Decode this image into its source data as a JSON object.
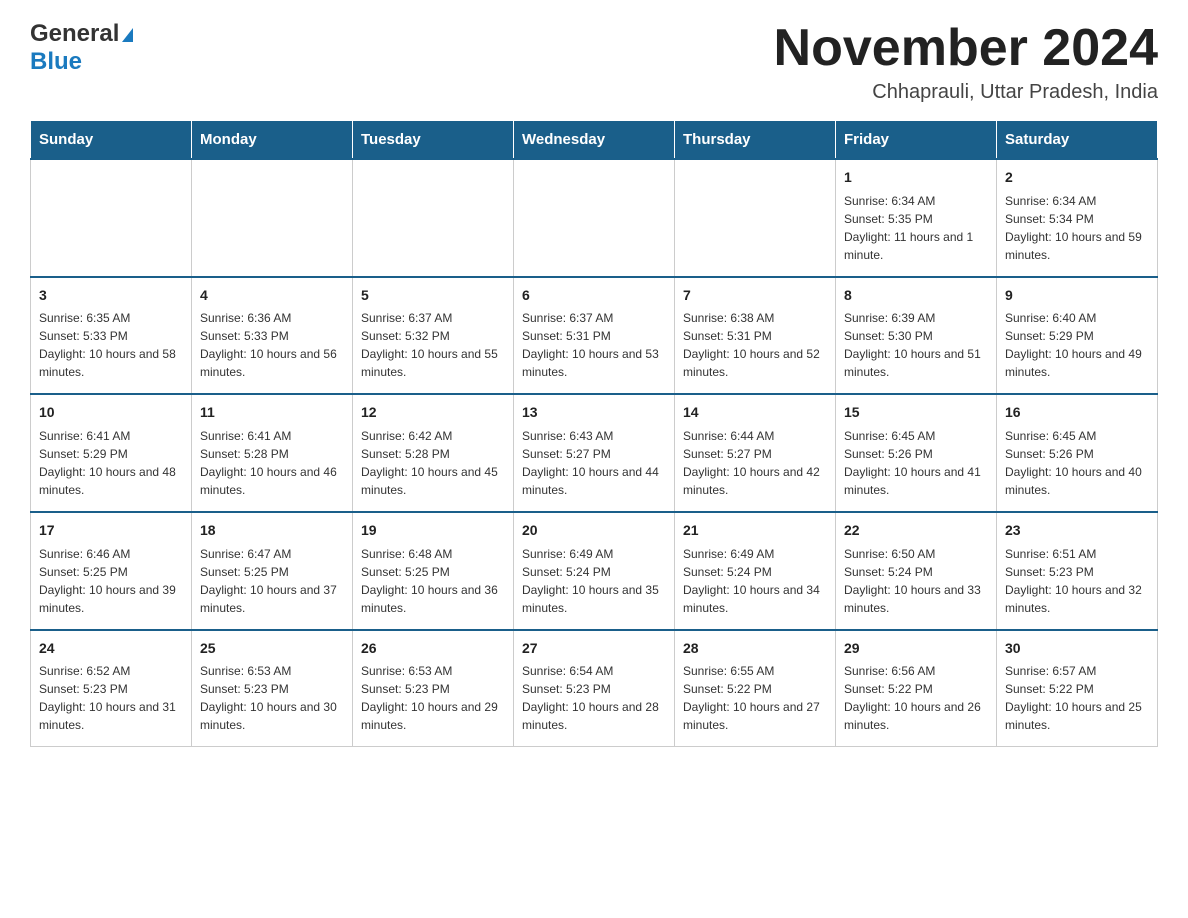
{
  "header": {
    "logo_general": "General",
    "logo_blue": "Blue",
    "month_title": "November 2024",
    "location": "Chhaprauli, Uttar Pradesh, India"
  },
  "weekdays": [
    "Sunday",
    "Monday",
    "Tuesday",
    "Wednesday",
    "Thursday",
    "Friday",
    "Saturday"
  ],
  "weeks": [
    [
      {
        "day": "",
        "info": ""
      },
      {
        "day": "",
        "info": ""
      },
      {
        "day": "",
        "info": ""
      },
      {
        "day": "",
        "info": ""
      },
      {
        "day": "",
        "info": ""
      },
      {
        "day": "1",
        "info": "Sunrise: 6:34 AM\nSunset: 5:35 PM\nDaylight: 11 hours and 1 minute."
      },
      {
        "day": "2",
        "info": "Sunrise: 6:34 AM\nSunset: 5:34 PM\nDaylight: 10 hours and 59 minutes."
      }
    ],
    [
      {
        "day": "3",
        "info": "Sunrise: 6:35 AM\nSunset: 5:33 PM\nDaylight: 10 hours and 58 minutes."
      },
      {
        "day": "4",
        "info": "Sunrise: 6:36 AM\nSunset: 5:33 PM\nDaylight: 10 hours and 56 minutes."
      },
      {
        "day": "5",
        "info": "Sunrise: 6:37 AM\nSunset: 5:32 PM\nDaylight: 10 hours and 55 minutes."
      },
      {
        "day": "6",
        "info": "Sunrise: 6:37 AM\nSunset: 5:31 PM\nDaylight: 10 hours and 53 minutes."
      },
      {
        "day": "7",
        "info": "Sunrise: 6:38 AM\nSunset: 5:31 PM\nDaylight: 10 hours and 52 minutes."
      },
      {
        "day": "8",
        "info": "Sunrise: 6:39 AM\nSunset: 5:30 PM\nDaylight: 10 hours and 51 minutes."
      },
      {
        "day": "9",
        "info": "Sunrise: 6:40 AM\nSunset: 5:29 PM\nDaylight: 10 hours and 49 minutes."
      }
    ],
    [
      {
        "day": "10",
        "info": "Sunrise: 6:41 AM\nSunset: 5:29 PM\nDaylight: 10 hours and 48 minutes."
      },
      {
        "day": "11",
        "info": "Sunrise: 6:41 AM\nSunset: 5:28 PM\nDaylight: 10 hours and 46 minutes."
      },
      {
        "day": "12",
        "info": "Sunrise: 6:42 AM\nSunset: 5:28 PM\nDaylight: 10 hours and 45 minutes."
      },
      {
        "day": "13",
        "info": "Sunrise: 6:43 AM\nSunset: 5:27 PM\nDaylight: 10 hours and 44 minutes."
      },
      {
        "day": "14",
        "info": "Sunrise: 6:44 AM\nSunset: 5:27 PM\nDaylight: 10 hours and 42 minutes."
      },
      {
        "day": "15",
        "info": "Sunrise: 6:45 AM\nSunset: 5:26 PM\nDaylight: 10 hours and 41 minutes."
      },
      {
        "day": "16",
        "info": "Sunrise: 6:45 AM\nSunset: 5:26 PM\nDaylight: 10 hours and 40 minutes."
      }
    ],
    [
      {
        "day": "17",
        "info": "Sunrise: 6:46 AM\nSunset: 5:25 PM\nDaylight: 10 hours and 39 minutes."
      },
      {
        "day": "18",
        "info": "Sunrise: 6:47 AM\nSunset: 5:25 PM\nDaylight: 10 hours and 37 minutes."
      },
      {
        "day": "19",
        "info": "Sunrise: 6:48 AM\nSunset: 5:25 PM\nDaylight: 10 hours and 36 minutes."
      },
      {
        "day": "20",
        "info": "Sunrise: 6:49 AM\nSunset: 5:24 PM\nDaylight: 10 hours and 35 minutes."
      },
      {
        "day": "21",
        "info": "Sunrise: 6:49 AM\nSunset: 5:24 PM\nDaylight: 10 hours and 34 minutes."
      },
      {
        "day": "22",
        "info": "Sunrise: 6:50 AM\nSunset: 5:24 PM\nDaylight: 10 hours and 33 minutes."
      },
      {
        "day": "23",
        "info": "Sunrise: 6:51 AM\nSunset: 5:23 PM\nDaylight: 10 hours and 32 minutes."
      }
    ],
    [
      {
        "day": "24",
        "info": "Sunrise: 6:52 AM\nSunset: 5:23 PM\nDaylight: 10 hours and 31 minutes."
      },
      {
        "day": "25",
        "info": "Sunrise: 6:53 AM\nSunset: 5:23 PM\nDaylight: 10 hours and 30 minutes."
      },
      {
        "day": "26",
        "info": "Sunrise: 6:53 AM\nSunset: 5:23 PM\nDaylight: 10 hours and 29 minutes."
      },
      {
        "day": "27",
        "info": "Sunrise: 6:54 AM\nSunset: 5:23 PM\nDaylight: 10 hours and 28 minutes."
      },
      {
        "day": "28",
        "info": "Sunrise: 6:55 AM\nSunset: 5:22 PM\nDaylight: 10 hours and 27 minutes."
      },
      {
        "day": "29",
        "info": "Sunrise: 6:56 AM\nSunset: 5:22 PM\nDaylight: 10 hours and 26 minutes."
      },
      {
        "day": "30",
        "info": "Sunrise: 6:57 AM\nSunset: 5:22 PM\nDaylight: 10 hours and 25 minutes."
      }
    ]
  ]
}
